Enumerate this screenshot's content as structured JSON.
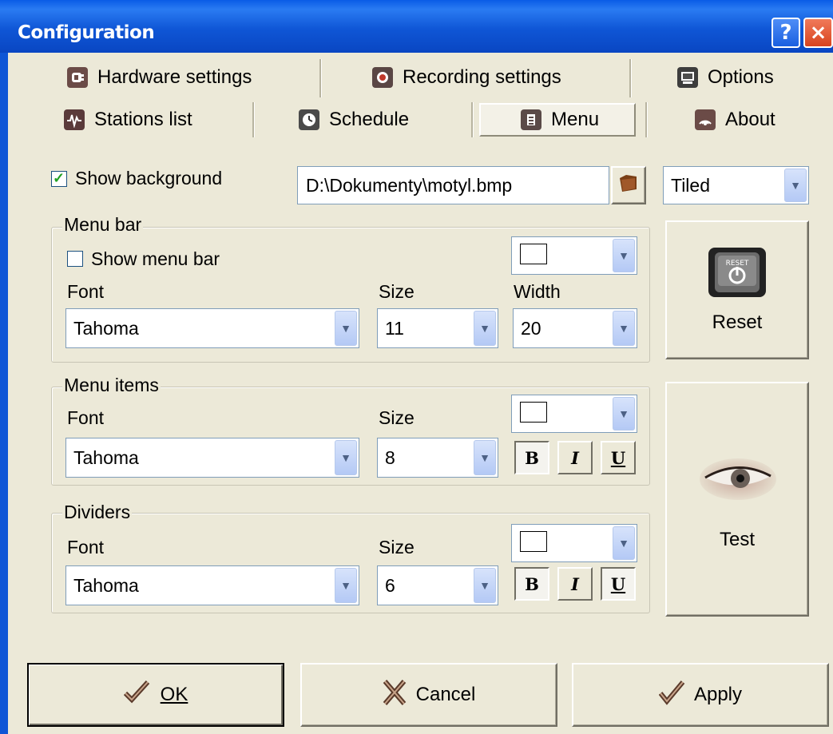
{
  "window": {
    "title": "Configuration",
    "help_label": "?",
    "close_label": "×"
  },
  "tabs": {
    "hardware": "Hardware settings",
    "recording": "Recording settings",
    "options": "Options",
    "stations": "Stations list",
    "schedule": "Schedule",
    "menu": "Menu",
    "about": "About"
  },
  "background": {
    "show_label": "Show background",
    "checked": true,
    "path": "D:\\Dokumenty\\motyl.bmp",
    "mode": "Tiled"
  },
  "menu_bar": {
    "title": "Menu bar",
    "show_label": "Show menu bar",
    "checked": false,
    "font_label": "Font",
    "size_label": "Size",
    "width_label": "Width",
    "font": "Tahoma",
    "size": "11",
    "width": "20",
    "color": "#ffffff"
  },
  "menu_items": {
    "title": "Menu items",
    "font_label": "Font",
    "size_label": "Size",
    "font": "Tahoma",
    "size": "8",
    "color": "#ffffff",
    "bold": true,
    "italic": false,
    "underline": false,
    "bold_label": "B",
    "italic_label": "I",
    "underline_label": "U"
  },
  "dividers": {
    "title": "Dividers",
    "font_label": "Font",
    "size_label": "Size",
    "font": "Tahoma",
    "size": "6",
    "color": "#ffffff",
    "bold": true,
    "italic": false,
    "underline": true,
    "bold_label": "B",
    "italic_label": "I",
    "underline_label": "U"
  },
  "side_buttons": {
    "reset": "Reset",
    "test": "Test",
    "reset_icon_text": "RESET"
  },
  "footer": {
    "ok": "OK",
    "cancel": "Cancel",
    "apply": "Apply"
  },
  "icons": {
    "hardware": "plug-icon",
    "recording": "record-icon",
    "options": "monitor-icon",
    "stations": "waveform-icon",
    "schedule": "clock-icon",
    "menu": "menu-icon",
    "about": "signal-icon",
    "folder": "folder-icon",
    "reset": "power-reset-icon",
    "test": "eye-icon"
  },
  "colors": {
    "titlebar": "#0f56d6",
    "face": "#ece9d8",
    "check": "#21a121"
  }
}
